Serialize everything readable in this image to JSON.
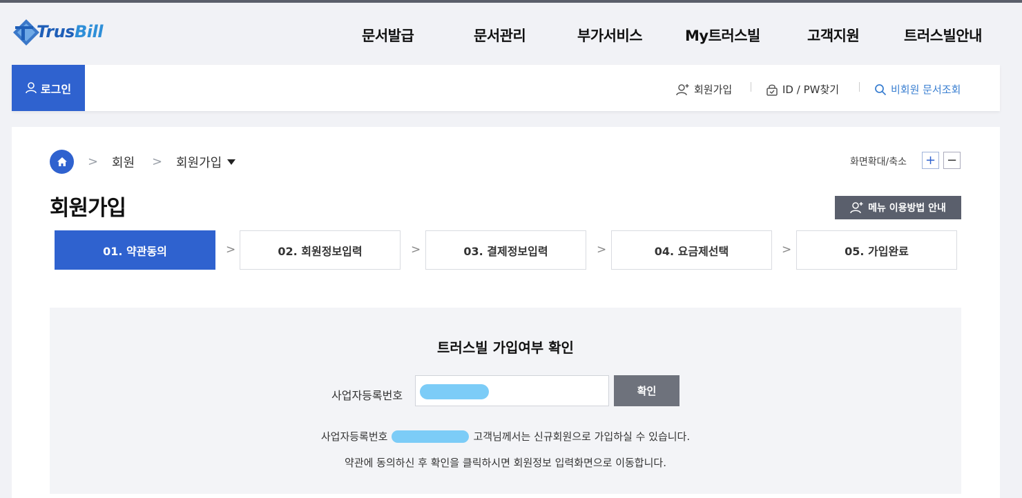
{
  "header": {
    "logo_text_a": "Trus",
    "logo_text_b": "Bill",
    "nav": [
      "문서발급",
      "문서관리",
      "부가서비스",
      "My트러스빌",
      "고객지원",
      "트러스빌안내"
    ]
  },
  "loginbar": {
    "login_label": "로그인",
    "signup_label": "회원가입",
    "find_label": "ID / PW찾기",
    "guest_lookup_label": "비회원 문서조회"
  },
  "breadcrumb": {
    "level1": "회원",
    "level2": "회원가입"
  },
  "zoom": {
    "label": "화면확대/축소",
    "plus": "+",
    "minus": "−"
  },
  "page": {
    "title": "회원가입",
    "menu_guide_label": "메뉴 이용방법 안내"
  },
  "steps": [
    {
      "label": "01. 약관동의",
      "active": true
    },
    {
      "label": "02. 회원정보입력",
      "active": false
    },
    {
      "label": "03. 결제정보입력",
      "active": false
    },
    {
      "label": "04. 요금제선택",
      "active": false
    },
    {
      "label": "05. 가입완료",
      "active": false
    }
  ],
  "check": {
    "title": "트러스빌 가입여부 확인",
    "field_label": "사업자등록번호",
    "confirm_label": "확인",
    "msg_prefix": "사업자등록번호",
    "msg_suffix": "고객님께서는 신규회원으로 가입하실 수 있습니다.",
    "msg2": "약관에 동의하신 후 확인을 클릭하시면 회원정보 입력화면으로 이동합니다."
  },
  "colors": {
    "accent": "#2f62cf",
    "dark_button": "#5a5f6c",
    "redaction": "#7cccf7"
  }
}
